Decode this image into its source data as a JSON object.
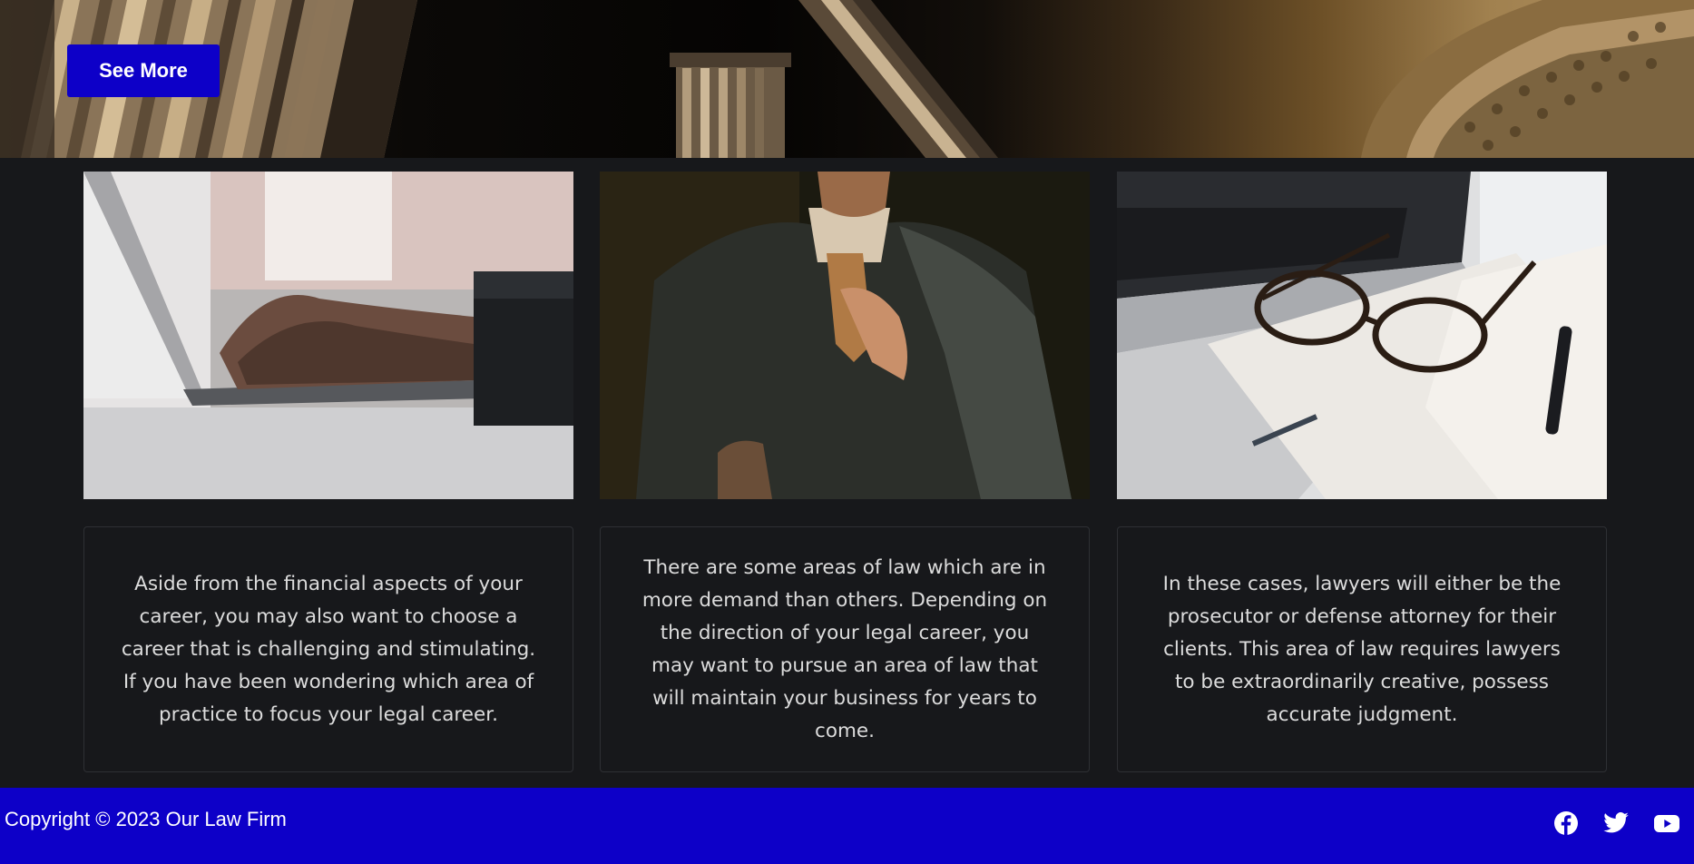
{
  "hero": {
    "button_label": "See More",
    "button_color": "#0d00c8"
  },
  "cards": [
    {
      "image": "laptop-typing-photo",
      "text": "Aside from the financial aspects of your career, you may also want to choose a career that is challenging and stimulating. If you have been wondering which area of practice to focus your legal career."
    },
    {
      "image": "man-in-suit-photo",
      "text": "There are some areas of law which are in more demand than others. Depending on the direction of your legal career, you may want to pursue an area of law that will maintain your business for years to come."
    },
    {
      "image": "glasses-notebook-photo",
      "text": "In these cases, lawyers will either be the prosecutor or defense attorney for their clients. This area of law requires lawyers to be extraordinarily creative, possess accurate judgment."
    }
  ],
  "footer": {
    "copyright": "Copyright © 2023 Our Law Firm",
    "background": "#0d00c8",
    "social": [
      "facebook-icon",
      "twitter-icon",
      "youtube-icon"
    ]
  },
  "colors": {
    "page_background": "#17181b",
    "text": "#dcdcdc",
    "card_border": "#2e3034"
  }
}
